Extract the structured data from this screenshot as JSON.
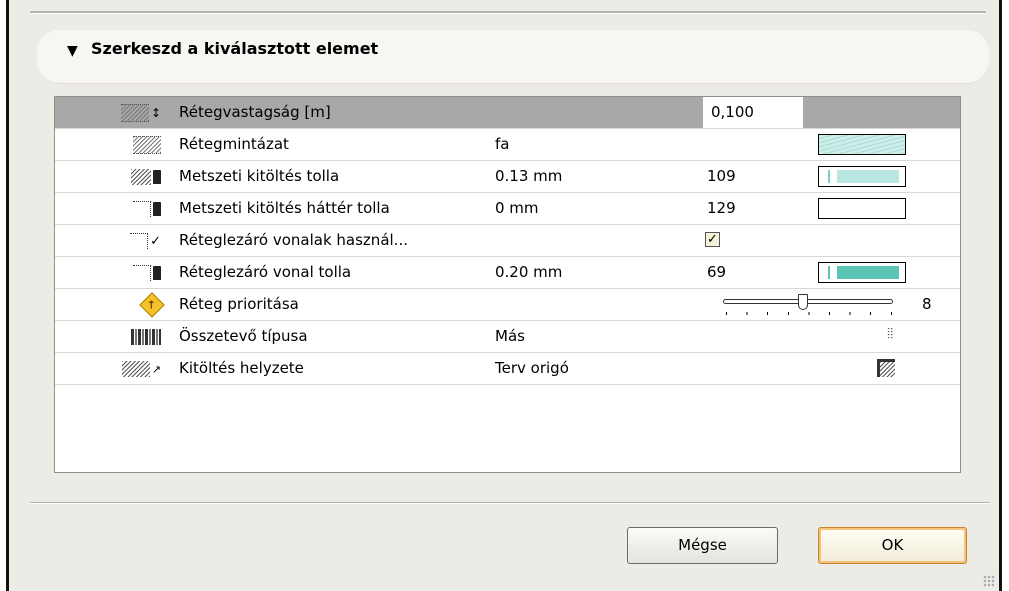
{
  "section": {
    "title": "Szerkeszd a kiválasztott elemet",
    "toggle_icon": "triangle-down-icon"
  },
  "rows": [
    {
      "name": "Rétegvastagság [m]",
      "value": "",
      "num": "0,100",
      "icon": "layer-thickness-icon"
    },
    {
      "name": "Rétegmintázat",
      "value": "fa",
      "num": "",
      "icon": "hatch-pattern-icon"
    },
    {
      "name": "Metszeti kitöltés tolla",
      "value": "0.13 mm",
      "num": "109",
      "icon": "cut-fill-pen-icon",
      "pen_color": "#b9e6e1"
    },
    {
      "name": "Metszeti kitöltés háttér tolla",
      "value": "0 mm",
      "num": "129",
      "icon": "cut-fill-background-pen-icon",
      "pen_color": "#ffffff"
    },
    {
      "name": "Réteglezáró vonalak használ...",
      "value": "",
      "num": "",
      "icon": "skin-end-lines-check-icon",
      "checked": true
    },
    {
      "name": "Réteglezáró vonal tolla",
      "value": "0.20 mm",
      "num": "69",
      "icon": "skin-end-line-pen-icon",
      "pen_color": "#5cc4b5"
    },
    {
      "name": "Réteg prioritása",
      "value": "",
      "num": "8",
      "icon": "priority-diamond-icon",
      "slider_fraction": 0.5
    },
    {
      "name": "Összetevő típusa",
      "value": "Más",
      "num": "",
      "icon": "component-type-icon"
    },
    {
      "name": "Kitöltés helyzete",
      "value": "Terv origó",
      "num": "",
      "icon": "fill-orientation-icon"
    }
  ],
  "buttons": {
    "cancel": "Mégse",
    "ok": "OK"
  },
  "colors": {
    "selected_row": "#a8a8a8",
    "ok_border": "#c9852d"
  }
}
